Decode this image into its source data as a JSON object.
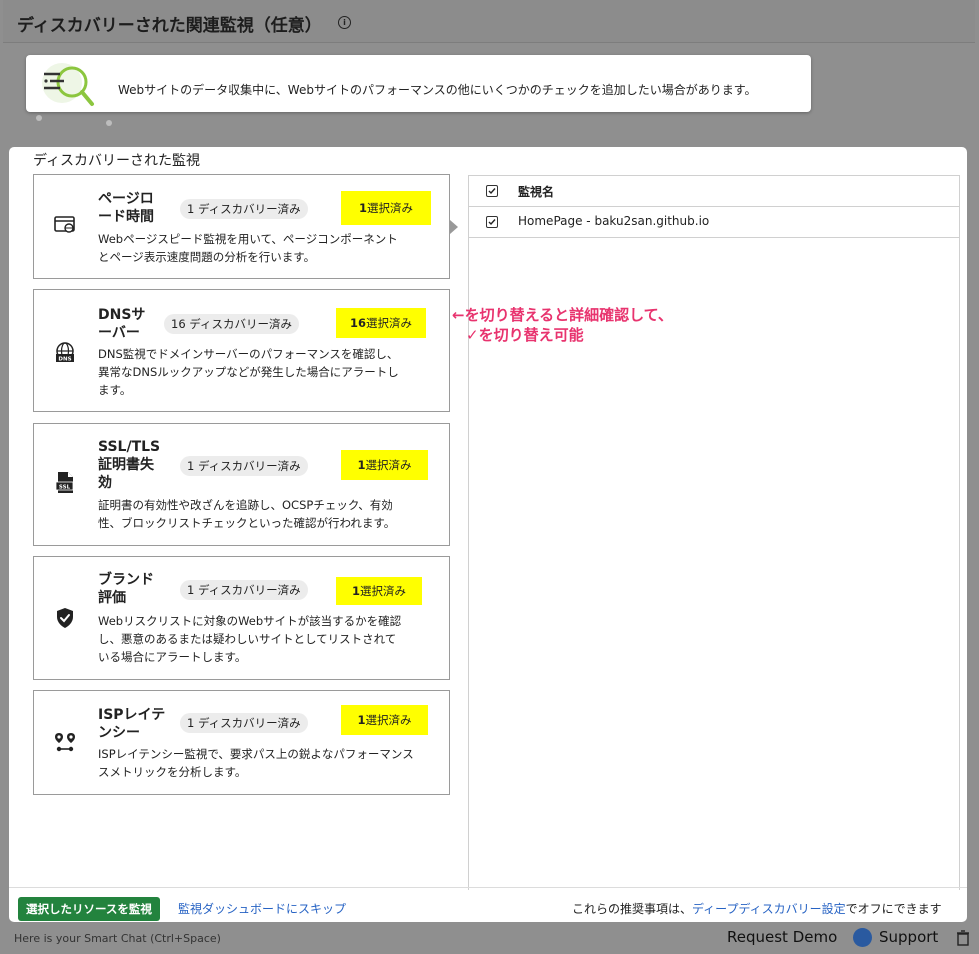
{
  "page": {
    "title": "ディスカバリーされた関連監視（任意）",
    "info_icon": "ⓘ"
  },
  "banner": {
    "text": "Webサイトのデータ収集中に、Webサイトのパフォーマンスの他にいくつかのチェックを追加したい場合があります。",
    "icon": "search-list-icon"
  },
  "panel": {
    "title": "ディスカバリーされた監視",
    "cards": [
      {
        "title_l1": "ページロ",
        "title_l2": "ード時間",
        "title_l3": "",
        "discovered": "1 ディスカバリー済み",
        "selected_num": "1",
        "selected_label": "選択済み",
        "desc_l1": "Webページスピード監視を用いて、ページコンポーネント",
        "desc_l2": "とページ表示速度問題の分析を行います。",
        "desc_l3": "",
        "icon": "browser-globe-icon"
      },
      {
        "title_l1": "DNSサ",
        "title_l2": "ーバー",
        "title_l3": "",
        "discovered": "16 ディスカバリー済み",
        "selected_num": "16",
        "selected_label": "選択済み",
        "desc_l1": "DNS監視でドメインサーバーのパフォーマンスを確認し、",
        "desc_l2": "異常なDNSルックアップなどが発生した場合にアラートし",
        "desc_l3": "ます。",
        "icon": "dns-globe-icon"
      },
      {
        "title_l1": "SSL/TLS",
        "title_l2": "証明書失",
        "title_l3": "効",
        "discovered": "1 ディスカバリー済み",
        "selected_num": "1",
        "selected_label": "選択済み",
        "desc_l1": "証明書の有効性や改ざんを追跡し、OCSPチェック、有効",
        "desc_l2": "性、ブロックリストチェックといった確認が行われます。",
        "desc_l3": "",
        "icon": "ssl-certificate-icon"
      },
      {
        "title_l1": "ブランド",
        "title_l2": "評価",
        "title_l3": "",
        "discovered": "1 ディスカバリー済み",
        "selected_num": "1",
        "selected_label": "選択済み",
        "desc_l1": "Webリスクリストに対象のWebサイトが該当するかを確認",
        "desc_l2": "し、悪意のあるまたは疑わしいサイトとしてリストされて",
        "desc_l3": "いる場合にアラートします。",
        "icon": "shield-check-icon"
      },
      {
        "title_l1": "ISPレイテ",
        "title_l2": "ンシー",
        "title_l3": "",
        "discovered": "1 ディスカバリー済み",
        "selected_num": "1",
        "selected_label": "選択済み",
        "desc_l1": "ISPレイテンシー監視で、要求パス上の鋭よなパフォーマンス",
        "desc_l2": "スメトリックを分析します。",
        "desc_l3": "",
        "icon": "route-pins-icon"
      }
    ]
  },
  "table": {
    "header": "監視名",
    "rows": [
      {
        "name": "HomePage - baku2san.github.io",
        "checked": true
      }
    ]
  },
  "annotation": {
    "line1": "←を切り替えると詳細確認して、",
    "line2": "✓を切り替え可能"
  },
  "footer": {
    "primary_button": "選択したリソースを監視",
    "skip_link": "監視ダッシュボードにスキップ",
    "note_prefix": "これらの推奨事項は、",
    "note_link": "ディープディスカバリー設定",
    "note_suffix": "でオフにできます"
  },
  "bottom_bar": {
    "smart_chat": "Here is your Smart Chat (Ctrl+Space)",
    "request_demo": "Request Demo",
    "support": "Support"
  },
  "colors": {
    "highlight": "#ffff00",
    "primary_button": "#23833e",
    "link": "#2763c4",
    "annotation": "#e8336e"
  }
}
